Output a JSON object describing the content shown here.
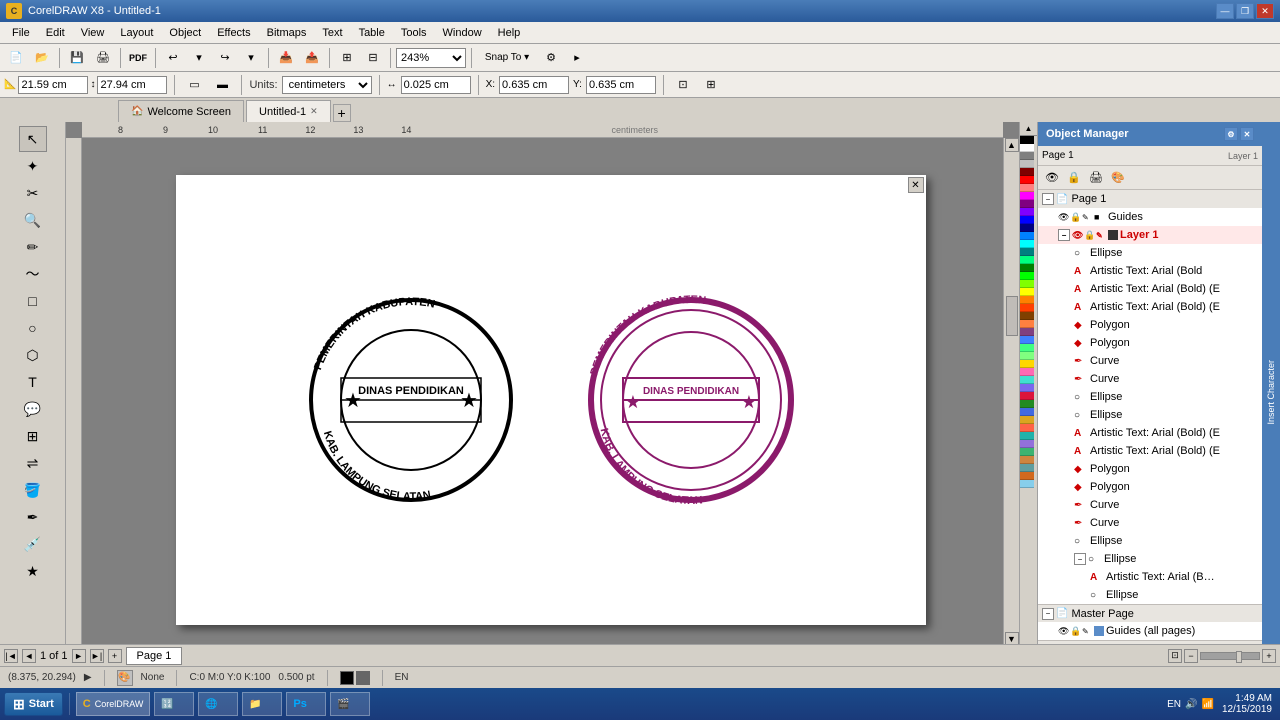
{
  "titlebar": {
    "title": "CorelDRAW X8 - Untitled-1",
    "icon": "C",
    "minimize": "—",
    "restore": "❐",
    "close": "✕"
  },
  "menu": {
    "items": [
      "File",
      "Edit",
      "View",
      "Layout",
      "Object",
      "Effects",
      "Bitmaps",
      "Text",
      "Table",
      "Tools",
      "Window",
      "Help"
    ]
  },
  "toolbar": {
    "zoom_value": "243%",
    "snap_to": "Snap To",
    "width_label": "21.59 cm",
    "height_label": "27.94 cm",
    "units_label": "Units:",
    "units_value": "centimeters",
    "nudge_value": "0.025 cm",
    "x_value": "0.635 cm",
    "y_value": "0.635 cm"
  },
  "tabs": {
    "welcome": "Welcome Screen",
    "doc": "Untitled-1",
    "add": "+"
  },
  "canvas": {
    "page_label": "Page 1",
    "page_of": "1 of 1",
    "page_tab": "Page 1"
  },
  "stamps": {
    "black": {
      "line1": "PEMERINTAH KABUPATEN",
      "center": "DINAS PENDIDIKAN",
      "line3": "KAB. LAMPUNG SELATAN",
      "color": "#000000",
      "stroke": "#000000"
    },
    "purple": {
      "line1": "PEMERINTAH KABUPATEN",
      "center": "DINAS PENDIDIKAN",
      "line3": "KAB. LAMPUNG SELATAN",
      "color": "#8B1A6B",
      "stroke": "#8B1A6B"
    }
  },
  "object_manager": {
    "title": "Object Manager",
    "page1": "Page 1",
    "guides": "Guides",
    "layer1": "Layer 1",
    "items": [
      {
        "level": 3,
        "type": "ellipse",
        "label": "Ellipse",
        "icon": "○"
      },
      {
        "level": 3,
        "type": "text",
        "label": "Artistic Text: Arial (Bold",
        "icon": "A"
      },
      {
        "level": 3,
        "type": "text",
        "label": "Artistic Text: Arial (Bold) (E)",
        "icon": "A"
      },
      {
        "level": 3,
        "type": "text",
        "label": "Artistic Text: Arial (Bold) (E)",
        "icon": "A"
      },
      {
        "level": 3,
        "type": "polygon",
        "label": "Polygon",
        "icon": "◆"
      },
      {
        "level": 3,
        "type": "polygon",
        "label": "Polygon",
        "icon": "◆"
      },
      {
        "level": 3,
        "type": "curve",
        "label": "Curve",
        "icon": "🖊"
      },
      {
        "level": 3,
        "type": "curve",
        "label": "Curve",
        "icon": "🖊"
      },
      {
        "level": 3,
        "type": "ellipse",
        "label": "Ellipse",
        "icon": "○"
      },
      {
        "level": 3,
        "type": "ellipse",
        "label": "Ellipse",
        "icon": "○"
      },
      {
        "level": 3,
        "type": "text",
        "label": "Artistic Text: Arial (Bold) (E)",
        "icon": "A"
      },
      {
        "level": 3,
        "type": "text",
        "label": "Artistic Text: Arial (Bold) (E)",
        "icon": "A"
      },
      {
        "level": 3,
        "type": "polygon",
        "label": "Polygon",
        "icon": "◆"
      },
      {
        "level": 3,
        "type": "polygon",
        "label": "Polygon",
        "icon": "◆"
      },
      {
        "level": 3,
        "type": "curve",
        "label": "Curve",
        "icon": "🖊"
      },
      {
        "level": 3,
        "type": "curve",
        "label": "Curve",
        "icon": "🖊"
      },
      {
        "level": 3,
        "type": "ellipse",
        "label": "Ellipse",
        "icon": "○"
      },
      {
        "level": 2,
        "type": "group",
        "label": "Ellipse",
        "icon": "○",
        "expand": true
      },
      {
        "level": 3,
        "type": "text",
        "label": "Artistic Text: Arial (Bold",
        "icon": "A"
      }
    ],
    "master_page": "Master Page",
    "guides_all": "Guides (all pages)"
  },
  "statusbar": {
    "coords": "(8.375, 20.294)",
    "fill": "None",
    "color_model": "C:0 M:0 Y:0 K:100",
    "opacity": "0.500 pt"
  },
  "taskbar": {
    "start": "Start",
    "apps": [
      "CorelDRAW",
      "Calculator",
      "Chrome",
      "Files",
      "Photoshop",
      "Media"
    ],
    "time": "1:49 AM",
    "date": "12/15/2019",
    "lang": "EN"
  },
  "colors": {
    "accent_blue": "#4a7db8",
    "accent_purple": "#8B1A6B",
    "black": "#000000",
    "palette": [
      "#FFFFFF",
      "#000000",
      "#FF0000",
      "#00FF00",
      "#0000FF",
      "#FFFF00",
      "#FF00FF",
      "#00FFFF",
      "#800000",
      "#008000",
      "#000080",
      "#808000",
      "#800080",
      "#008080",
      "#C0C0C0",
      "#808080",
      "#FF8080",
      "#80FF80",
      "#8080FF",
      "#FFFF80",
      "#FF80FF",
      "#80FFFF",
      "#FF8000",
      "#80FF00",
      "#0080FF",
      "#FF0080",
      "#8000FF",
      "#00FF80",
      "#FF4000",
      "#40FF00",
      "#0040FF",
      "#FF0040"
    ]
  }
}
